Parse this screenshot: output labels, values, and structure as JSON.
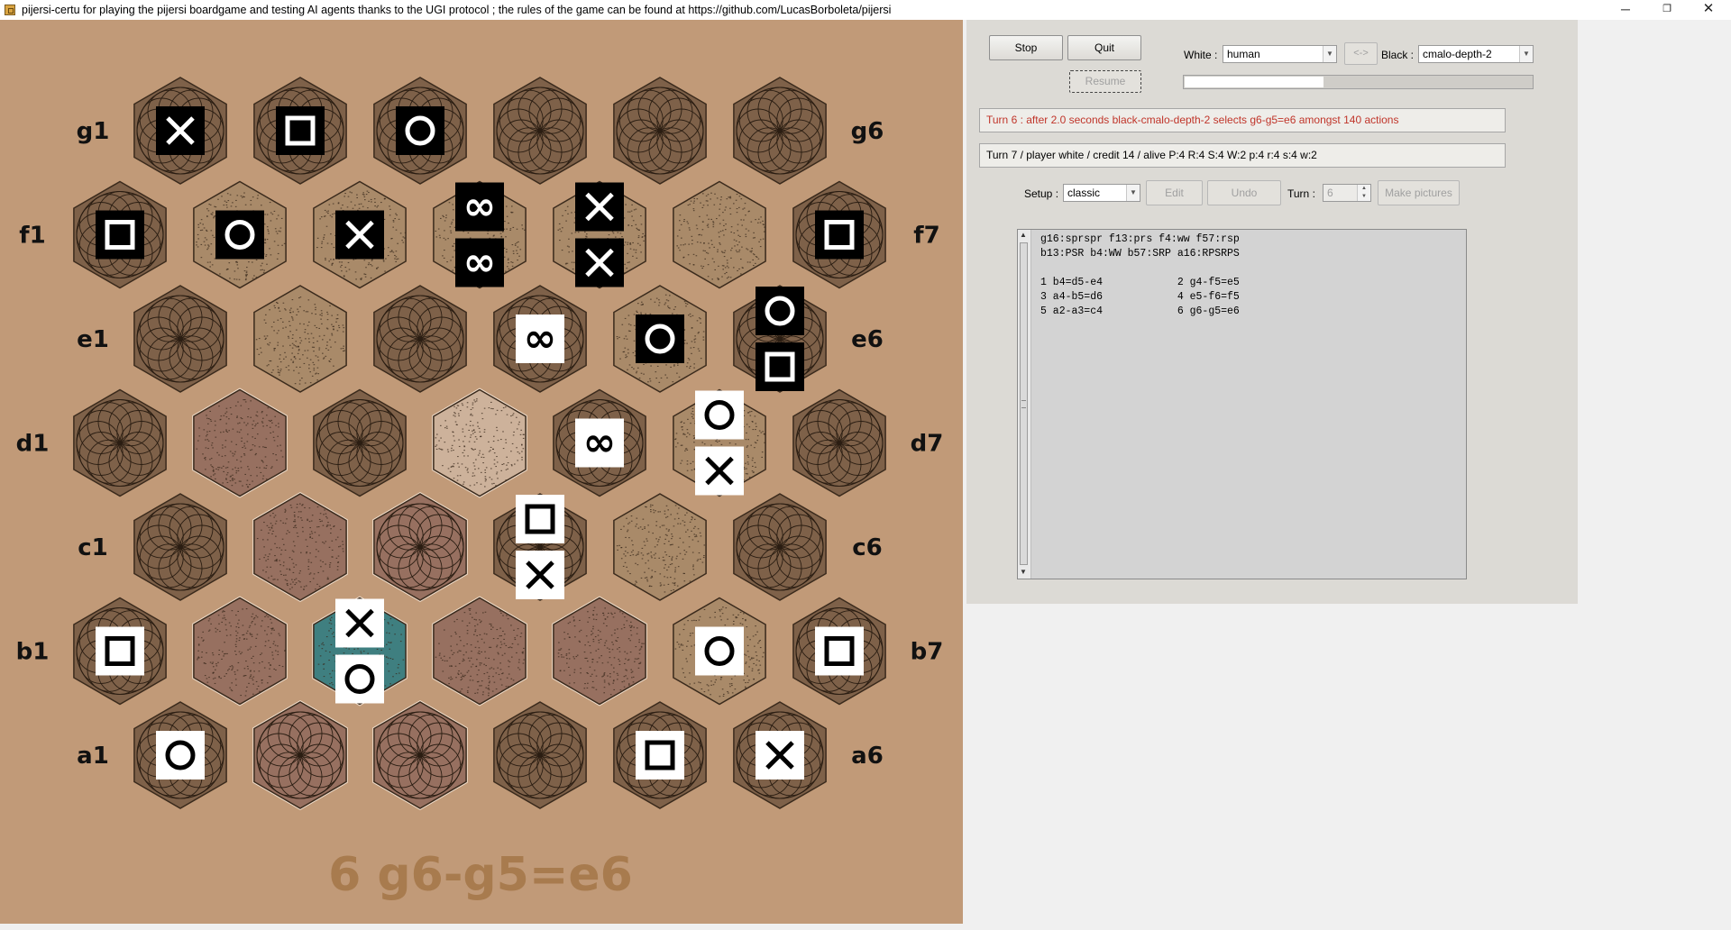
{
  "window": {
    "title": "pijersi-certu for playing the pijersi boardgame and testing AI agents thanks to the UGI protocol ; the rules of the game can be found at https://github.com/LucasBorboleta/pijersi",
    "minimize": "─",
    "maximize": "❐",
    "close": "✕"
  },
  "colors": {
    "board_background": "#c19a78",
    "white_piece": "#ffffff",
    "black_piece": "#000000",
    "last_move_highlight": "#3f7f80",
    "move_text": "#a87b4e",
    "turn_message": "#c0352a"
  },
  "board": {
    "row_labels": {
      "left": [
        "g1",
        "f1",
        "e1",
        "d1",
        "c1",
        "b1",
        "a1"
      ],
      "right": [
        "g6",
        "f7",
        "e6",
        "d7",
        "c6",
        "b7",
        "a6"
      ]
    },
    "cells": [
      {
        "id": "g1",
        "look": "rosette",
        "hl": "none",
        "stack": [
          {
            "side": "black",
            "kind": "scissors"
          }
        ]
      },
      {
        "id": "g2",
        "look": "rosette",
        "hl": "none",
        "stack": [
          {
            "side": "black",
            "kind": "paper"
          }
        ]
      },
      {
        "id": "g3",
        "look": "rosette",
        "hl": "none",
        "stack": [
          {
            "side": "black",
            "kind": "rock"
          }
        ]
      },
      {
        "id": "g4",
        "look": "rosette",
        "hl": "none",
        "stack": []
      },
      {
        "id": "g5",
        "look": "rosette",
        "hl": "none",
        "stack": []
      },
      {
        "id": "g6",
        "look": "rosette",
        "hl": "none",
        "stack": []
      },
      {
        "id": "f1",
        "look": "rosette",
        "hl": "none",
        "stack": [
          {
            "side": "black",
            "kind": "paper"
          }
        ]
      },
      {
        "id": "f2",
        "look": "speckle",
        "hl": "none",
        "stack": [
          {
            "side": "black",
            "kind": "rock"
          }
        ]
      },
      {
        "id": "f3",
        "look": "speckle",
        "hl": "none",
        "stack": [
          {
            "side": "black",
            "kind": "scissors"
          }
        ]
      },
      {
        "id": "f4",
        "look": "speckle",
        "hl": "none",
        "stack": [
          {
            "side": "black",
            "kind": "wise"
          },
          {
            "side": "black",
            "kind": "wise"
          }
        ]
      },
      {
        "id": "f5",
        "look": "speckle",
        "hl": "none",
        "stack": [
          {
            "side": "black",
            "kind": "scissors"
          },
          {
            "side": "black",
            "kind": "scissors"
          }
        ]
      },
      {
        "id": "f6",
        "look": "speckle",
        "hl": "none",
        "stack": []
      },
      {
        "id": "f7",
        "look": "rosette",
        "hl": "none",
        "stack": [
          {
            "side": "black",
            "kind": "paper"
          }
        ]
      },
      {
        "id": "e1",
        "look": "rosette",
        "hl": "none",
        "stack": []
      },
      {
        "id": "e2",
        "look": "speckle",
        "hl": "none",
        "stack": []
      },
      {
        "id": "e3",
        "look": "rosette",
        "hl": "none",
        "stack": []
      },
      {
        "id": "e4",
        "look": "rosette",
        "hl": "none",
        "stack": [
          {
            "side": "white",
            "kind": "wise"
          }
        ]
      },
      {
        "id": "e5",
        "look": "speckle",
        "hl": "none",
        "stack": [
          {
            "side": "black",
            "kind": "rock"
          }
        ]
      },
      {
        "id": "e6",
        "look": "rosette",
        "hl": "none",
        "stack": [
          {
            "side": "black",
            "kind": "rock"
          },
          {
            "side": "black",
            "kind": "paper"
          }
        ]
      },
      {
        "id": "d1",
        "look": "rosette",
        "hl": "none",
        "stack": []
      },
      {
        "id": "d2",
        "look": "speckle",
        "hl": "area",
        "stack": []
      },
      {
        "id": "d3",
        "look": "rosette",
        "hl": "none",
        "stack": []
      },
      {
        "id": "d4",
        "look": "speckle",
        "hl": "light",
        "stack": []
      },
      {
        "id": "d5",
        "look": "rosette",
        "hl": "none",
        "stack": [
          {
            "side": "white",
            "kind": "wise"
          }
        ]
      },
      {
        "id": "d6",
        "look": "speckle",
        "hl": "none",
        "stack": [
          {
            "side": "white",
            "kind": "rock"
          },
          {
            "side": "white",
            "kind": "scissors"
          }
        ]
      },
      {
        "id": "d7",
        "look": "rosette",
        "hl": "none",
        "stack": []
      },
      {
        "id": "c1",
        "look": "rosette",
        "hl": "none",
        "stack": []
      },
      {
        "id": "c2",
        "look": "speckle",
        "hl": "area",
        "stack": []
      },
      {
        "id": "c3",
        "look": "rosette",
        "hl": "area",
        "stack": []
      },
      {
        "id": "c4",
        "look": "rosette",
        "hl": "none",
        "stack": [
          {
            "side": "white",
            "kind": "paper"
          },
          {
            "side": "white",
            "kind": "scissors"
          }
        ]
      },
      {
        "id": "c5",
        "look": "speckle",
        "hl": "none",
        "stack": []
      },
      {
        "id": "c6",
        "look": "rosette",
        "hl": "none",
        "stack": []
      },
      {
        "id": "b1",
        "look": "rosette",
        "hl": "none",
        "stack": [
          {
            "side": "white",
            "kind": "paper"
          }
        ]
      },
      {
        "id": "b2",
        "look": "speckle",
        "hl": "area",
        "stack": []
      },
      {
        "id": "b3",
        "look": "speckle",
        "hl": "teal",
        "stack": [
          {
            "side": "white",
            "kind": "scissors"
          },
          {
            "side": "white",
            "kind": "rock"
          }
        ]
      },
      {
        "id": "b4",
        "look": "speckle",
        "hl": "area",
        "stack": []
      },
      {
        "id": "b5",
        "look": "speckle",
        "hl": "area",
        "stack": []
      },
      {
        "id": "b6",
        "look": "speckle",
        "hl": "none",
        "stack": [
          {
            "side": "white",
            "kind": "rock"
          }
        ]
      },
      {
        "id": "b7",
        "look": "rosette",
        "hl": "none",
        "stack": [
          {
            "side": "white",
            "kind": "paper"
          }
        ]
      },
      {
        "id": "a1",
        "look": "rosette",
        "hl": "none",
        "stack": [
          {
            "side": "white",
            "kind": "rock"
          }
        ]
      },
      {
        "id": "a2",
        "look": "rosette",
        "hl": "area",
        "stack": []
      },
      {
        "id": "a3",
        "look": "rosette",
        "hl": "area",
        "stack": []
      },
      {
        "id": "a4",
        "look": "rosette",
        "hl": "none",
        "stack": []
      },
      {
        "id": "a5",
        "look": "rosette",
        "hl": "none",
        "stack": [
          {
            "side": "white",
            "kind": "paper"
          }
        ]
      },
      {
        "id": "a6",
        "look": "rosette",
        "hl": "none",
        "stack": [
          {
            "side": "white",
            "kind": "scissors"
          }
        ]
      }
    ],
    "last_move": "6 g6-g5=e6"
  },
  "controls": {
    "stop_label": "Stop",
    "quit_label": "Quit",
    "resume_label": "Resume",
    "white_label": "White :",
    "white_value": "human",
    "swap_label": "<->",
    "black_label": "Black :",
    "black_value": "cmalo-depth-2",
    "progress_fraction": 0.4,
    "turn_message": "Turn 6 : after 2.0 seconds black-cmalo-depth-2 selects g6-g5=e6 amongst 140 actions",
    "status_message": "Turn 7 / player white / credit 14 / alive P:4 R:4 S:4 W:2 p:4 r:4 s:4 w:2",
    "setup_label": "Setup :",
    "setup_value": "classic",
    "edit_label": "Edit",
    "undo_label": "Undo",
    "turn_label": "Turn :",
    "turn_value": "6",
    "make_pictures_label": "Make pictures"
  },
  "history": {
    "position_lines": "g16:sprspr f13:prs f4:ww f57:rsp\nb13:PSR b4:WW b57:SRP a16:RPSRPS",
    "moves": [
      "1 b4=d5-e4            2 g4-f5=e5",
      "3 a4-b5=d6            4 e5-f6=f5",
      "5 a2-a3=c4            6 g6-g5=e6"
    ]
  }
}
